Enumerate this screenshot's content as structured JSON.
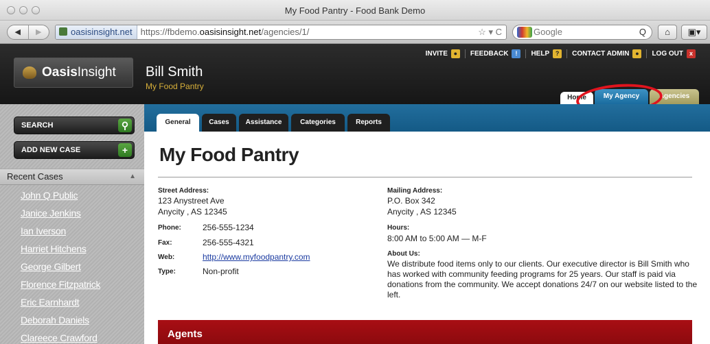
{
  "window": {
    "title": "My Food Pantry - Food Bank Demo"
  },
  "browser": {
    "nav_back": "◀",
    "nav_forward": "▶",
    "site_badge": "oasisinsight.net",
    "url_prefix": "https://fbdemo.",
    "url_host": "oasisinsight.net",
    "url_path": "/agencies/1/",
    "url_icons": "☆ ▾  C",
    "search_placeholder": "Google",
    "search_icon": "Q",
    "home_icon": "⌂",
    "bookmark_icon": "▣▾"
  },
  "header": {
    "logo_bold": "Oasis",
    "logo_rest": "Insight",
    "user_name": "Bill Smith",
    "user_org": "My Food Pantry",
    "links": [
      {
        "label": "INVITE",
        "icon": "user-icon",
        "glyph": "●"
      },
      {
        "label": "FEEDBACK",
        "icon": "feedback-icon",
        "glyph": "!"
      },
      {
        "label": "HELP",
        "icon": "help-icon",
        "glyph": "?"
      },
      {
        "label": "CONTACT ADMIN",
        "icon": "admin-icon",
        "glyph": "●"
      },
      {
        "label": "LOG OUT",
        "icon": "logout-icon",
        "glyph": "x"
      }
    ],
    "tabs": {
      "home": "Home",
      "agency": "My Agency",
      "agencies": "Agencies"
    }
  },
  "sidebar": {
    "search_label": "SEARCH",
    "search_icon_glyph": "⚲",
    "add_case_label": "ADD NEW CASE",
    "add_icon_glyph": "+",
    "recent_title": "Recent Cases",
    "collapse_glyph": "▲",
    "recent": [
      "John Q Public",
      "Janice Jenkins",
      "Ian Iverson",
      "Harriet Hitchens",
      "George Gilbert",
      "Florence Fitzpatrick",
      "Eric Earnhardt",
      "Deborah Daniels",
      "Clareece Crawford"
    ]
  },
  "subtabs": [
    "General",
    "Cases",
    "Assistance",
    "Categories",
    "Reports"
  ],
  "page": {
    "title": "My Food Pantry",
    "street_label": "Street Address:",
    "street_line1": "123 Anystreet Ave",
    "street_line2": "Anycity , AS 12345",
    "phone_label": "Phone:",
    "phone": "256-555-1234",
    "fax_label": "Fax:",
    "fax": "256-555-4321",
    "web_label": "Web:",
    "web": "http://www.myfoodpantry.com",
    "type_label": "Type:",
    "type": "Non-profit",
    "mailing_label": "Mailing Address:",
    "mailing_line1": "P.O. Box 342",
    "mailing_line2": "Anycity , AS 12345",
    "hours_label": "Hours:",
    "hours": "8:00 AM to 5:00 AM  —  M-F",
    "about_label": "About Us:",
    "about": "We distribute food items only to our clients. Our executive director is Bill Smith who has worked with community feeding programs for 25 years. Our staff is paid via donations from the community. We accept donations 24/7 on our website listed to the left.",
    "agents_title": "Agents"
  },
  "colors": {
    "accent": "#1a6c9f",
    "highlight_ring": "#e0141e",
    "agents_bar": "#a80e14",
    "org_text": "#d8b03a"
  }
}
